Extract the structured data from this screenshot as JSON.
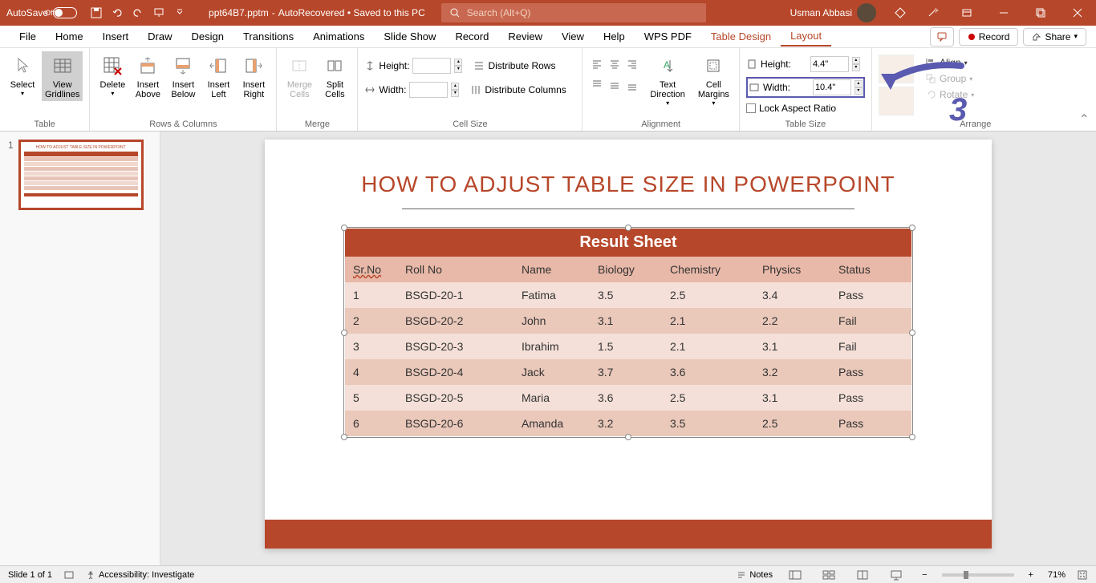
{
  "titlebar": {
    "autosave_label": "AutoSave",
    "autosave_state": "Off",
    "filename": "ppt64B7.pptm",
    "status": "AutoRecovered • Saved to this PC",
    "search_placeholder": "Search (Alt+Q)",
    "username": "Usman Abbasi"
  },
  "menubar": {
    "items": [
      "File",
      "Home",
      "Insert",
      "Draw",
      "Design",
      "Transitions",
      "Animations",
      "Slide Show",
      "Record",
      "Review",
      "View",
      "Help",
      "WPS PDF",
      "Table Design",
      "Layout"
    ],
    "active": "Layout",
    "record_btn": "Record",
    "share_btn": "Share"
  },
  "ribbon": {
    "table": {
      "label": "Table",
      "select": "Select",
      "view_gridlines": "View\nGridlines"
    },
    "rows_cols": {
      "label": "Rows & Columns",
      "delete": "Delete",
      "insert_above": "Insert\nAbove",
      "insert_below": "Insert\nBelow",
      "insert_left": "Insert\nLeft",
      "insert_right": "Insert\nRight"
    },
    "merge": {
      "label": "Merge",
      "merge_cells": "Merge\nCells",
      "split_cells": "Split\nCells"
    },
    "cell_size": {
      "label": "Cell Size",
      "height_label": "Height:",
      "height_value": "",
      "width_label": "Width:",
      "width_value": "",
      "dist_rows": "Distribute Rows",
      "dist_cols": "Distribute Columns"
    },
    "alignment": {
      "label": "Alignment",
      "text_direction": "Text\nDirection",
      "cell_margins": "Cell\nMargins"
    },
    "table_size": {
      "label": "Table Size",
      "height_label": "Height:",
      "height_value": "4.4\"",
      "width_label": "Width:",
      "width_value": "10.4\"",
      "lock_aspect": "Lock Aspect Ratio"
    },
    "arrange": {
      "label": "Arrange",
      "align": "Align",
      "group": "Group",
      "rotate": "Rotate"
    }
  },
  "annotation": {
    "number": "3"
  },
  "slide_panel": {
    "slides": [
      {
        "number": "1"
      }
    ]
  },
  "slide": {
    "title": "HOW TO ADJUST TABLE SIZE IN POWERPOINT",
    "table_title": "Result  Sheet",
    "headers": [
      "Sr.No",
      "Roll No",
      "Name",
      "Biology",
      "Chemistry",
      "Physics",
      "Status"
    ],
    "rows": [
      [
        "1",
        "BSGD-20-1",
        "Fatima",
        "3.5",
        "2.5",
        "3.4",
        "Pass"
      ],
      [
        "2",
        "BSGD-20-2",
        "John",
        "3.1",
        "2.1",
        "2.2",
        "Fail"
      ],
      [
        "3",
        "BSGD-20-3",
        "Ibrahim",
        "1.5",
        "2.1",
        "3.1",
        "Fail"
      ],
      [
        "4",
        "BSGD-20-4",
        "Jack",
        "3.7",
        "3.6",
        "3.2",
        "Pass"
      ],
      [
        "5",
        "BSGD-20-5",
        "Maria",
        "3.6",
        "2.5",
        "3.1",
        "Pass"
      ],
      [
        "6",
        "BSGD-20-6",
        "Amanda",
        "3.2",
        "3.5",
        "2.5",
        "Pass"
      ]
    ]
  },
  "statusbar": {
    "slide_info": "Slide 1 of 1",
    "accessibility": "Accessibility: Investigate",
    "notes": "Notes",
    "zoom": "71%"
  }
}
